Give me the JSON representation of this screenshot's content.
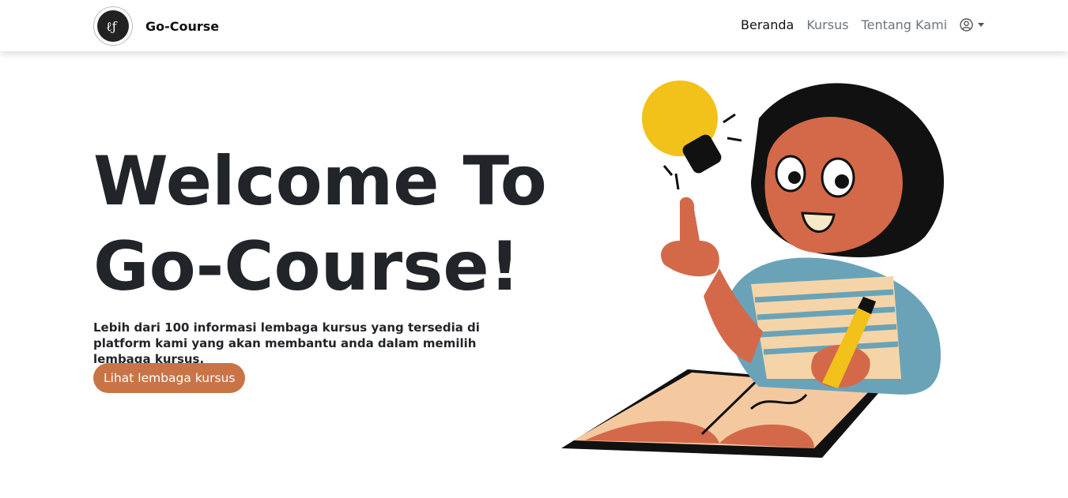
{
  "brand": {
    "name": "Go-Course",
    "logo_icon": "logo-icon"
  },
  "nav": {
    "items": [
      {
        "label": "Beranda",
        "active": true
      },
      {
        "label": "Kursus",
        "active": false
      },
      {
        "label": "Tentang Kami",
        "active": false
      }
    ],
    "user_icon": "user-circle-icon"
  },
  "hero": {
    "title_line1": "Welcome To",
    "title_line2": "Go-Course!",
    "description": "Lebih dari 100 informasi lembaga kursus yang tersedia di platform kami yang akan membantu anda dalam memilih lembaga kursus.",
    "cta_label": "Lihat lembaga kursus"
  },
  "colors": {
    "accent": "#c97446",
    "text": "#212529",
    "muted": "#6c757d"
  }
}
